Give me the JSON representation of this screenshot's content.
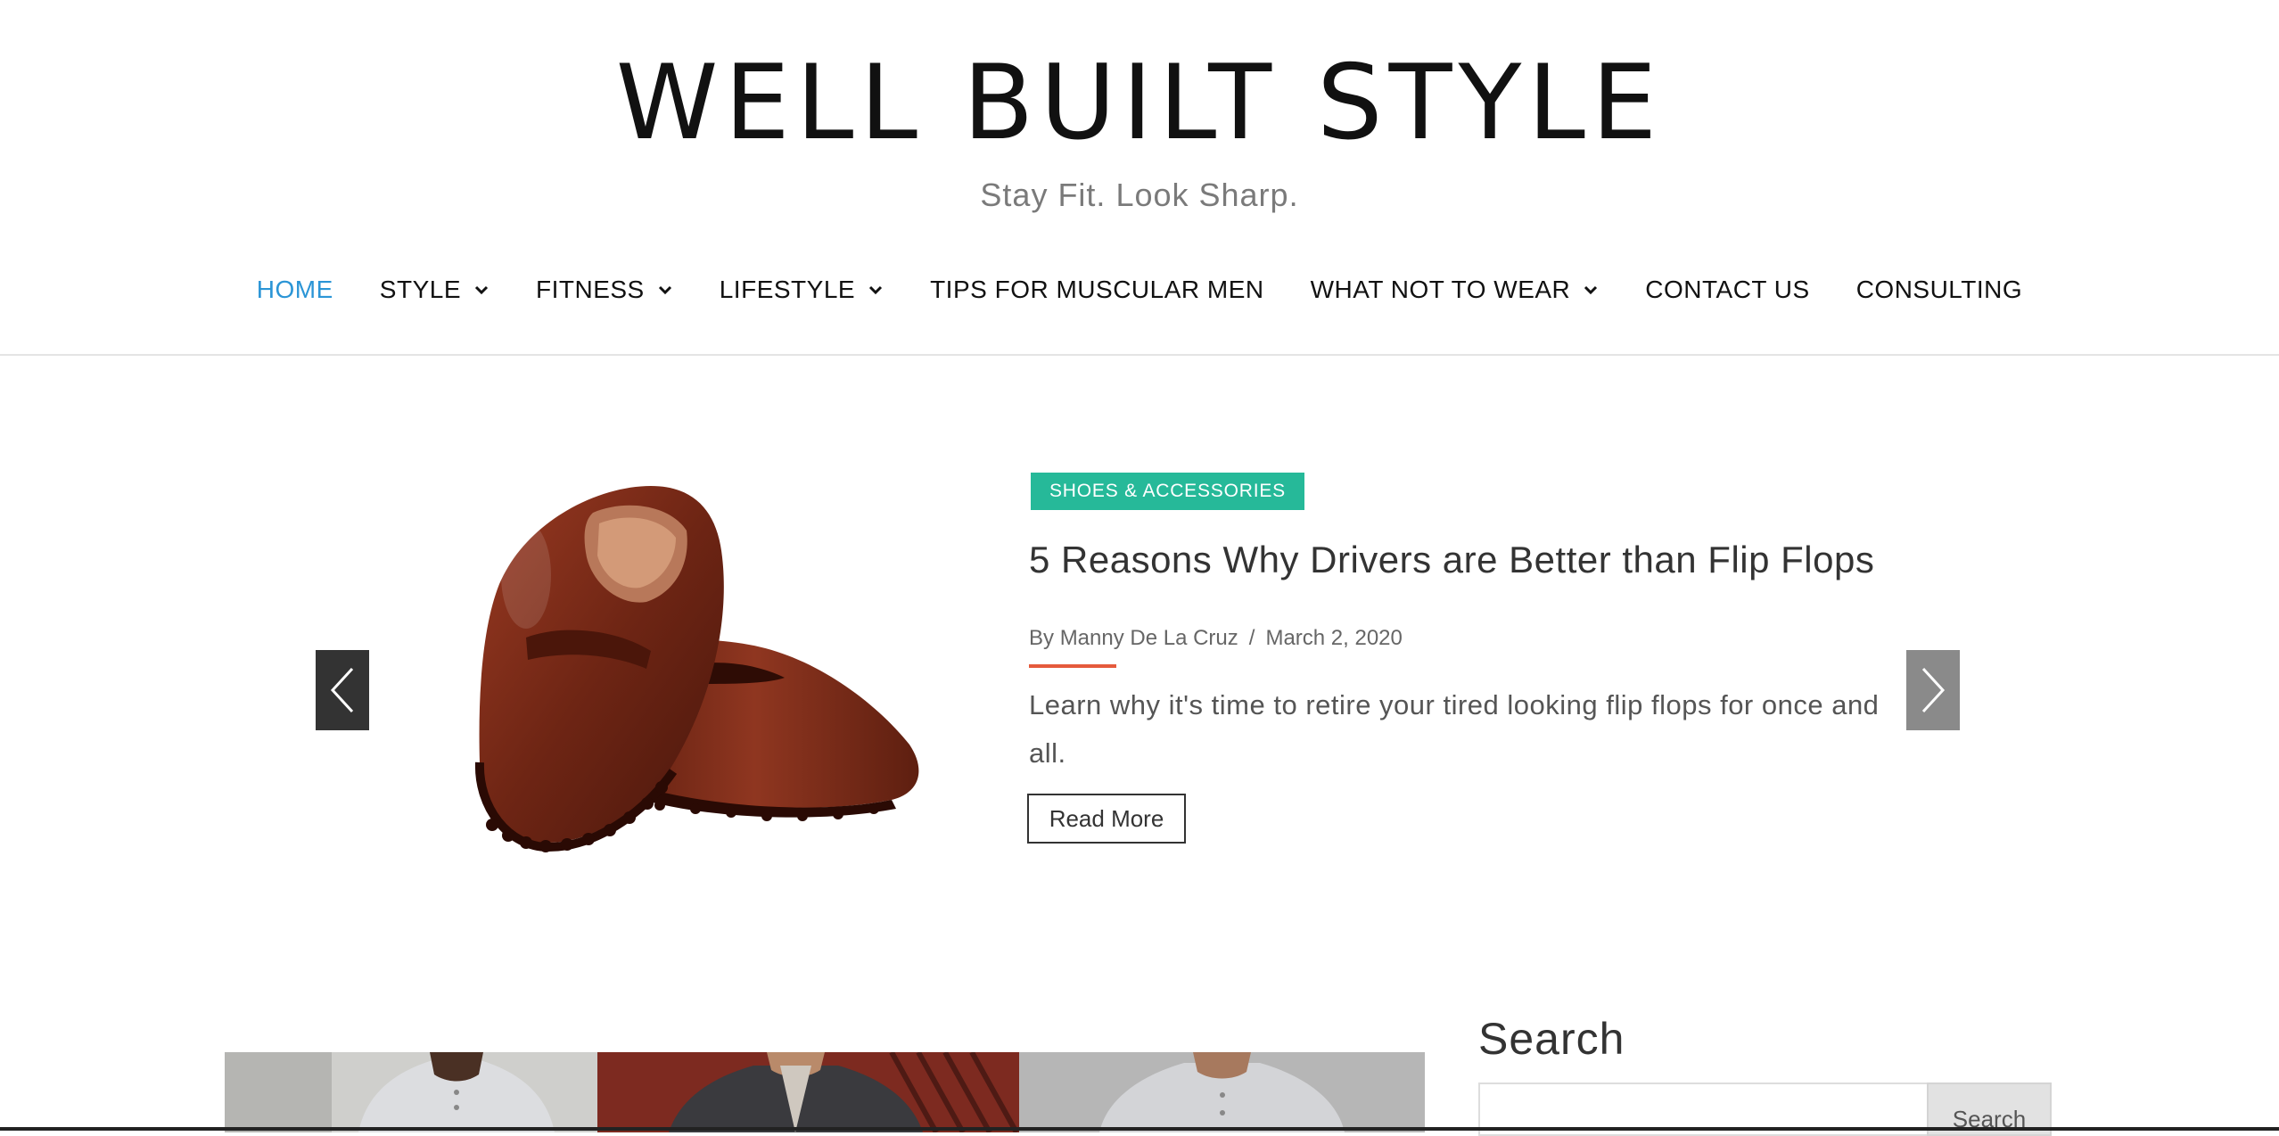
{
  "site": {
    "logo": "WELL BUILT STYLE",
    "tagline": "Stay Fit. Look Sharp."
  },
  "nav": {
    "items": [
      {
        "label": "HOME",
        "active": true,
        "dropdown": false
      },
      {
        "label": "STYLE",
        "active": false,
        "dropdown": true
      },
      {
        "label": "FITNESS",
        "active": false,
        "dropdown": true
      },
      {
        "label": "LIFESTYLE",
        "active": false,
        "dropdown": true
      },
      {
        "label": "TIPS FOR MUSCULAR MEN",
        "active": false,
        "dropdown": false
      },
      {
        "label": "WHAT NOT TO WEAR",
        "active": false,
        "dropdown": true
      },
      {
        "label": "CONTACT US",
        "active": false,
        "dropdown": false
      },
      {
        "label": "CONSULTING",
        "active": false,
        "dropdown": false
      }
    ]
  },
  "hero": {
    "category": "SHOES & ACCESSORIES",
    "title": "5 Reasons Why Drivers are Better than Flip Flops",
    "author_prefix": "By",
    "author": "Manny De La Cruz",
    "separator": "/",
    "date": "March 2, 2020",
    "excerpt": "Learn why it's time to retire your tired looking flip flops for once and all.",
    "read_more": "Read More"
  },
  "sidebar": {
    "search_title": "Search",
    "search_placeholder": "",
    "search_button": "Search"
  },
  "colors": {
    "nav_active": "#2b95d6",
    "badge": "#26b999",
    "accent_line": "#e55a3c"
  },
  "icons": {
    "prev": "chevron-left-icon",
    "next": "chevron-right-icon",
    "dropdown": "chevron-down-icon"
  }
}
